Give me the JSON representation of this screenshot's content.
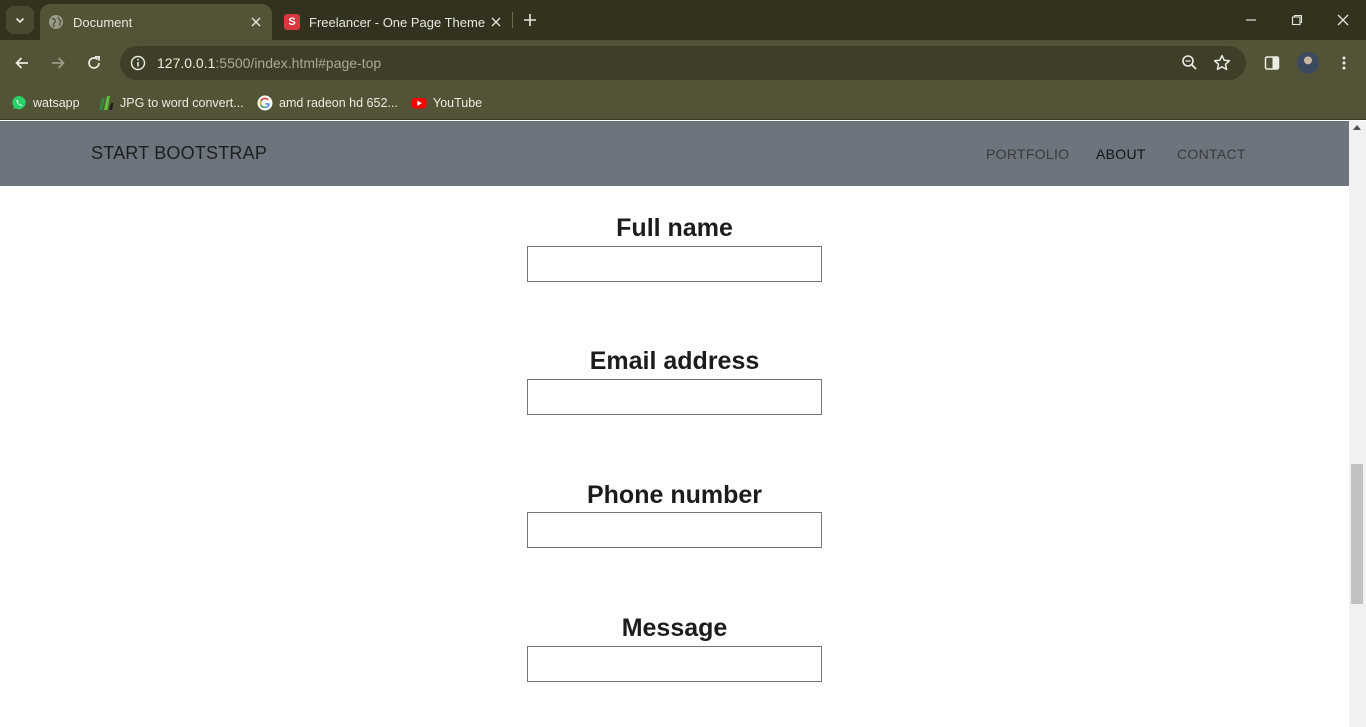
{
  "browser": {
    "tabs": [
      {
        "title": "Document",
        "active": true,
        "favicon": "globe-icon"
      },
      {
        "title": "Freelancer - One Page Theme -",
        "active": false,
        "favicon": "startbootstrap-s-icon"
      }
    ],
    "address": {
      "host": "127.0.0.1",
      "rest": ":5500/index.html#page-top"
    },
    "bookmarks": [
      {
        "label": "watsapp",
        "icon": "whatsapp-icon"
      },
      {
        "label": "JPG to word convert...",
        "icon": "jpg-to-word-icon"
      },
      {
        "label": "amd radeon hd 652...",
        "icon": "google-icon"
      },
      {
        "label": "YouTube",
        "icon": "youtube-icon"
      }
    ]
  },
  "site": {
    "brand": "START BOOTSTRAP",
    "nav": {
      "portfolio": "PORTFOLIO",
      "about": "ABOUT",
      "contact": "CONTACT"
    },
    "navbar_color": "#6c757d"
  },
  "form": {
    "full_name": {
      "label": "Full name",
      "value": ""
    },
    "email": {
      "label": "Email address",
      "value": ""
    },
    "phone": {
      "label": "Phone number",
      "value": ""
    },
    "message": {
      "label": "Message",
      "value": ""
    }
  }
}
